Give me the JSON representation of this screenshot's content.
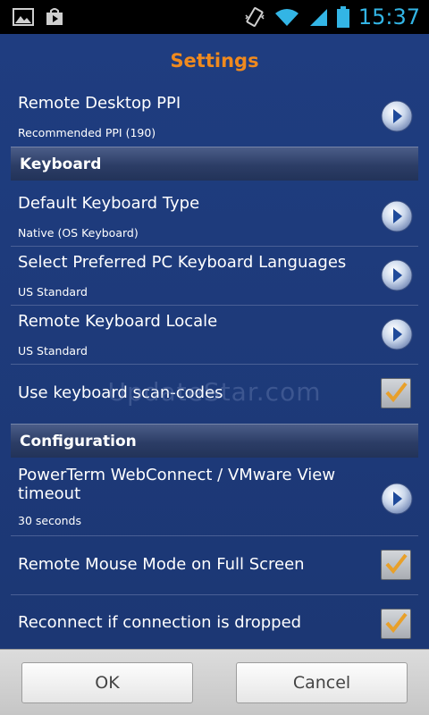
{
  "status_bar": {
    "time": "15:37",
    "icons": [
      "image-icon",
      "store-bag-icon",
      "vibrate-icon",
      "wifi-icon",
      "signal-icon",
      "battery-icon"
    ]
  },
  "settings": {
    "title": "Settings",
    "watermark": "UpdateStar.com",
    "rows": {
      "remote_desktop_ppi": {
        "title": "Remote Desktop PPI",
        "subtitle": "Recommended PPI (190)"
      },
      "default_keyboard_type": {
        "title": "Default Keyboard Type",
        "subtitle": "Native (OS Keyboard)"
      },
      "preferred_keyboard_languages": {
        "title": "Select Preferred PC Keyboard Languages",
        "subtitle": "US Standard"
      },
      "remote_keyboard_locale": {
        "title": "Remote Keyboard Locale",
        "subtitle": "US Standard"
      },
      "use_scan_codes": {
        "title": "Use keyboard scan-codes",
        "checked": true
      },
      "powerterm_timeout": {
        "title_line1": "PowerTerm WebConnect / VMware View",
        "title_line2": "timeout",
        "subtitle": "30 seconds"
      },
      "remote_mouse_mode": {
        "title": "Remote Mouse Mode on Full Screen",
        "checked": true
      },
      "reconnect_dropped": {
        "title": "Reconnect if connection is dropped",
        "checked": true
      }
    },
    "sections": {
      "keyboard": "Keyboard",
      "configuration": "Configuration"
    }
  },
  "buttons": {
    "ok": "OK",
    "cancel": "Cancel"
  },
  "colors": {
    "background": "#1d3a79",
    "title": "#f08a1e",
    "time": "#33b5e5",
    "check": "#e8a02a"
  }
}
